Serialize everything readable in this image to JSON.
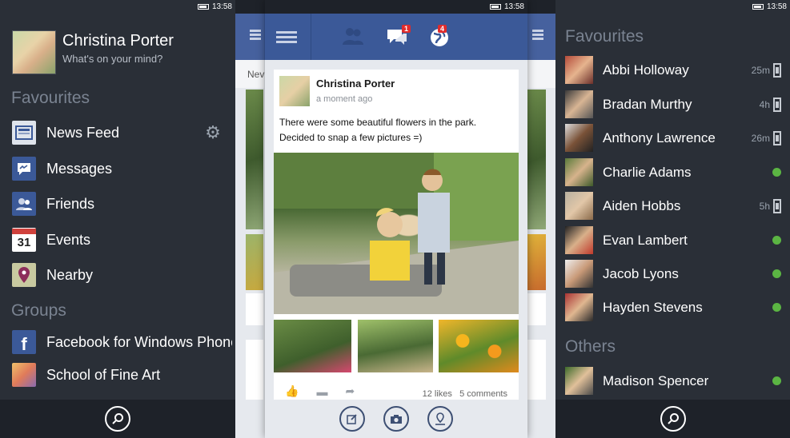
{
  "status": {
    "time": "13:58"
  },
  "left_panel": {
    "profile": {
      "name": "Christina Porter",
      "subtitle": "What's on your mind?"
    },
    "favourites_title": "Favourites",
    "favourites": [
      {
        "label": "News Feed",
        "icon": "news-feed-icon",
        "color": "#dfe4ec"
      },
      {
        "label": "Messages",
        "icon": "messages-icon",
        "color": "#3b5998"
      },
      {
        "label": "Friends",
        "icon": "friends-icon",
        "color": "#3b5998"
      },
      {
        "label": "Events",
        "icon": "calendar-icon",
        "day": "31",
        "color": "#ffffff"
      },
      {
        "label": "Nearby",
        "icon": "map-pin-icon",
        "color": "#c8c9a0"
      }
    ],
    "groups_title": "Groups",
    "groups": [
      {
        "label": "Facebook for Windows Phone",
        "icon": "facebook-icon",
        "color": "#3b5998"
      },
      {
        "label": "School of Fine Art",
        "icon": "group-photo-icon",
        "color": "#e6a35a"
      }
    ]
  },
  "middle_peek": {
    "tab_text": "Nev"
  },
  "top_bar": {
    "messages_badge": "1",
    "notifications_badge": "4"
  },
  "post": {
    "author": "Christina Porter",
    "time": "a moment ago",
    "text_line1": "There were some beautiful flowers in the park.",
    "text_line2": "Decided to snap a few pictures =)",
    "likes": "12 likes",
    "comments": "5 comments"
  },
  "right_panel": {
    "favourites_title": "Favourites",
    "favourites": [
      {
        "name": "Abbi Holloway",
        "time": "25m",
        "status": "mobile"
      },
      {
        "name": "Bradan Murthy",
        "time": "4h",
        "status": "mobile"
      },
      {
        "name": "Anthony Lawrence",
        "time": "26m",
        "status": "mobile"
      },
      {
        "name": "Charlie Adams",
        "time": "",
        "status": "online"
      },
      {
        "name": "Aiden Hobbs",
        "time": "5h",
        "status": "mobile"
      },
      {
        "name": "Evan Lambert",
        "time": "",
        "status": "online"
      },
      {
        "name": "Jacob Lyons",
        "time": "",
        "status": "online"
      },
      {
        "name": "Hayden Stevens",
        "time": "",
        "status": "online"
      }
    ],
    "others_title": "Others",
    "others": [
      {
        "name": "Madison Spencer",
        "time": "",
        "status": "online"
      }
    ]
  },
  "colors": {
    "accent_blue": "#3b5998",
    "panel_dark": "#2a2f37",
    "online_green": "#5bb543"
  }
}
